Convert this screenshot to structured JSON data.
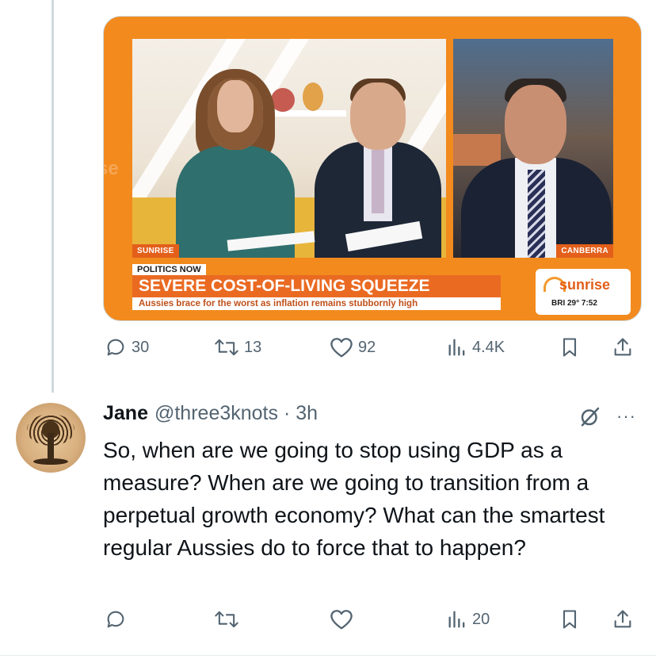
{
  "media": {
    "badge_left": "SUNRISE",
    "badge_right": "CANBERRA",
    "segment": "POLITICS NOW",
    "headline": "SEVERE COST-OF-LIVING SQUEEZE",
    "subline": "Aussies brace for the worst as inflation remains stubbornly high",
    "logo": "sunrise",
    "bug": "BRI 29° 7:52",
    "wall_text": "se"
  },
  "tweet_actions": {
    "replies": "30",
    "retweets": "13",
    "likes": "92",
    "views": "4.4K"
  },
  "reply": {
    "name": "Jane",
    "handle_time": "@three3knots · 3h",
    "text": "So, when are we going to stop using GDP as a measure? When are we going to transition from a perpetual growth economy? What can the smartest regular Aussies do to force that to happen?",
    "more": "···",
    "actions": {
      "views": "20"
    }
  },
  "colors": {
    "orange": "#f28a1e",
    "text": "#0f1419",
    "muted": "#536471"
  }
}
